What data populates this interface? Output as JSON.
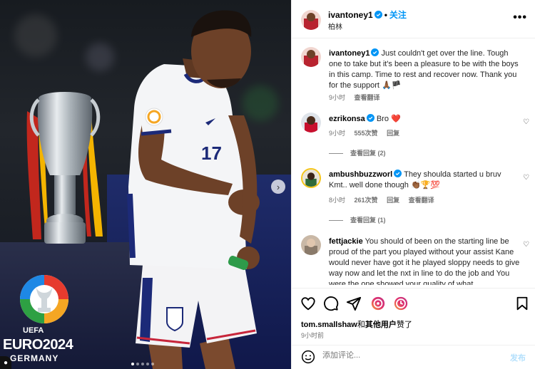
{
  "post": {
    "username": "ivantoney1",
    "location": "柏林",
    "follow_label": "关注",
    "more_label": "•••",
    "caption": "Just couldn't get over the line. Tough one to take but it's been a pleasure to be with the boys in this camp. Time to rest and recover now. Thank you for the support 🙏🏾🏴",
    "caption_time": "9小时",
    "caption_translate": "查看翻译"
  },
  "photo": {
    "uefa": "UEFA",
    "euro": "EURO2024",
    "germany": "GERMANY",
    "next_arrow": "›",
    "corner_label": "1"
  },
  "comments": [
    {
      "username": "ezrikonsa",
      "text": "Bro ❤️",
      "time": "9小时",
      "likes": "555次赞",
      "reply": "回复",
      "view_replies": "查看回复 (2)"
    },
    {
      "username": "ambushbuzzworl",
      "text": "They shoulda started u bruv Kmt.. well done though 👏🏾🏆💯",
      "time": "8小时",
      "likes": "261次赞",
      "reply": "回复",
      "translate": "查看翻译",
      "view_replies": "查看回复 (1)"
    },
    {
      "username": "fettjackie",
      "text": "You should of been on the starting line be proud of the part you played without your assist Kane would never have got it he played sloppy needs to give way now and let the nxt in line to do the job and You were the one showed your quality of what"
    }
  ],
  "likes_line": {
    "user": "tom.smallshaw",
    "and": "和",
    "others": "其他用户",
    "suffix": "赞了"
  },
  "post_time": "9小时前",
  "add_comment": {
    "placeholder": "添加评论...",
    "post_label": "发布"
  },
  "colors": {
    "accent": "#0095f6",
    "heart_red": "#ed4956",
    "muted": "#737373"
  }
}
